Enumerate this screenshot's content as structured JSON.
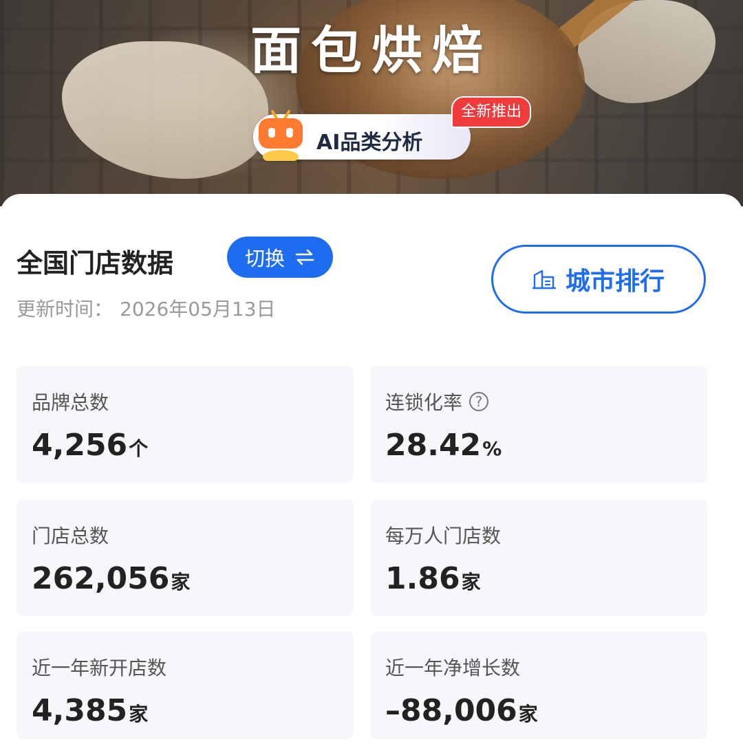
{
  "banner": {
    "title": "面包烘焙",
    "ai_label": "AI品类分析",
    "new_badge": "全新推出"
  },
  "section": {
    "title": "全国门店数据",
    "switch_label": "切换",
    "switch_icon": "swap-arrows-icon",
    "update_label": "更新时间：",
    "update_date": "2026年05月13日",
    "city_rank_label": "城市排行",
    "city_rank_icon": "city-building-icon"
  },
  "stats": [
    {
      "label": "品牌总数",
      "value": "4,256",
      "unit": "个",
      "help": false
    },
    {
      "label": "连锁化率",
      "value": "28.42",
      "unit": "%",
      "help": true
    },
    {
      "label": "门店总数",
      "value": "262,056",
      "unit": "家",
      "help": false
    },
    {
      "label": "每万人门店数",
      "value": "1.86",
      "unit": "家",
      "help": false
    },
    {
      "label": "近一年新开店数",
      "value": "4,385",
      "unit": "家",
      "help": false
    },
    {
      "label": "近一年净增长数",
      "value": "–88,006",
      "unit": "家",
      "help": false
    }
  ],
  "colors": {
    "accent": "#1e6cf0",
    "badge": "#ef3b3b",
    "card_bg": "#f6f7fa"
  }
}
